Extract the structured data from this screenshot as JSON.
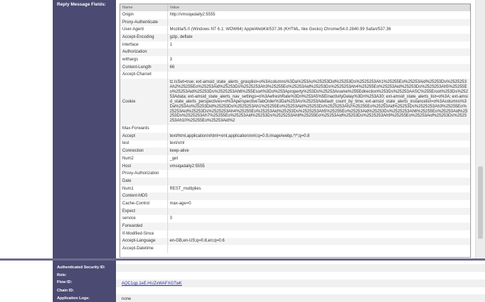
{
  "sidebar": {
    "reply_fields_label": "Reply Message Fields:"
  },
  "headers_table": {
    "columns": [
      "Name",
      "Value"
    ],
    "rows": [
      {
        "name": "Origin",
        "value": "http://vmsiqadaily2:5555"
      },
      {
        "name": "Proxy-Authenticate",
        "value": ""
      },
      {
        "name": "User-Agent",
        "value": "Mozilla/5.0 (Windows NT 6.1; WOW64) AppleWebKit/537.36 (KHTML, like Gecko) Chrome/54.0.2840.99 Safari/537.36"
      },
      {
        "name": "Accept-Encoding",
        "value": "gzip, deflate"
      },
      {
        "name": "interface",
        "value": "1"
      },
      {
        "name": "Authorization",
        "value": ""
      },
      {
        "name": "withargs",
        "value": "3"
      },
      {
        "name": "Content-Length",
        "value": "66"
      },
      {
        "name": "Accept-Charset",
        "value": ""
      },
      {
        "name": "Cookie",
        "value": "tz.IsSet=true; ext-amsid_state_alerts_grouplist=o%3Acolumns%3Da%253Ao%25253Did%25253Ds%2525253Ah1%25255Eo%25253Aid%25253Ds%2525253Ah2%25255Eo%25253Aid%25253Ds%2525253Ah3%25255Eo%25253Aid%25253Ds%2525253Ah4%25255Eo%25253Aid%25253Ds%2525253Ah5%25255Eo%25253Aid%25253Ds%2525253Ah6%255Esort%3Do%253Aproperty%253Ds%25253Aname%255Edirection%253Ds%25253AASC%255Eroot%253Ds%25253Adata; ext-amsid_state_alerts_nav_settings=o%3AefreshRate%3Dn%253A5%5EinactivityDelay%3Dn%253A30; ext-amsid_state_alerts_list=o%3A; ext-amsid_state_alerts_perspectives=o%3AperspectiveTabOrder%3Da%253As%25253Adefault_count_by_time; ext-amsid_state_alerts_instancelist=o%3Acolumns%3Da%253Ao%25253Did%25253Ds%2525253Ah1%25255Eo%25253Aid%25253Ds%2525253Ah2%25255Eo%25253Aid%25253Ds%2525253Ah3%25255Eo%25253Aid%25253Ds%2525253Ah4%25255Eo%25253Aid%25253Ds%2525253Ah5%25255Eo%25253Aid%25253Ds%2525253Ah6%25255Eo%25253Aid%25253Ds%2525253Ah7%25255Eo%25253Aid%25253Ds%2525253Ah8%25255Eo%25253Aid%25253Ds%2525253Ah9%25255Eo%25253Aid%25253Ds%2525253Ah10%25255Eo%25253Aid%2"
      },
      {
        "name": "Max-Forwards",
        "value": ""
      },
      {
        "name": "Accept",
        "value": "text/html,application/xhtml+xml,application/xml;q=0.9,image/webp,*/*;q=0.8"
      },
      {
        "name": "test",
        "value": "text/xml"
      },
      {
        "name": "Connection",
        "value": "keep-alive"
      },
      {
        "name": "Num2",
        "value": "_get"
      },
      {
        "name": "Host",
        "value": "vmsiqadaily2:5555"
      },
      {
        "name": "Proxy-Authorization",
        "value": ""
      },
      {
        "name": "Date",
        "value": ""
      },
      {
        "name": "Num1",
        "value": "REST_multiplies"
      },
      {
        "name": "Content-MD5",
        "value": ""
      },
      {
        "name": "Cache-Control",
        "value": "max-age=0"
      },
      {
        "name": "Expect",
        "value": ""
      },
      {
        "name": "service",
        "value": "3"
      },
      {
        "name": "Forwarded",
        "value": ""
      },
      {
        "name": "If-Modified-Since",
        "value": ""
      },
      {
        "name": "Accept-Language",
        "value": "en-GB,en-US;q=0.8,en;q=0.6"
      },
      {
        "name": "Accept-Datetime",
        "value": ""
      }
    ]
  },
  "details": {
    "auth_security_id_label": "Authenticated Security ID:",
    "role_label": "Role:",
    "flow_id_label": "Flow ID:",
    "flow_id_value": "AQC1qp.1eE.HUZxWAFXGTwK",
    "chain_id_label": "Chain ID:",
    "app_logs_label": "Application Logs:",
    "app_logs_value": "none"
  },
  "colors": {
    "sidebar_bg": "#4a4a72",
    "link": "#2a2ab8"
  }
}
